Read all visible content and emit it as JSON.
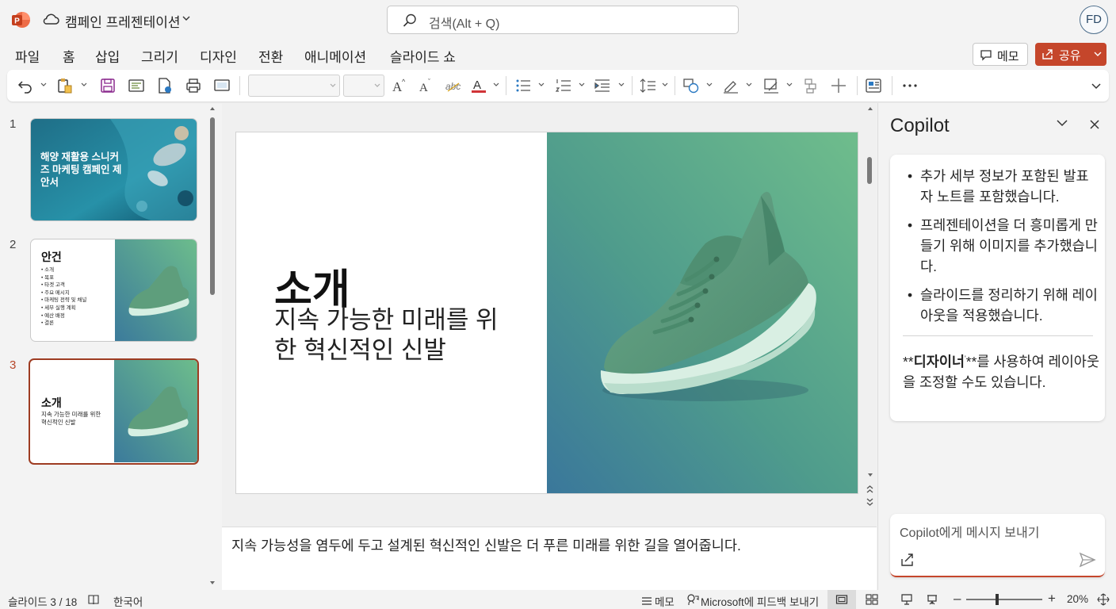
{
  "titlebar": {
    "doc_title": "캠페인 프레젠테이션",
    "search_placeholder": "검색(Alt + Q)",
    "avatar_initials": "FD"
  },
  "tabs": [
    {
      "label": "파일",
      "active": false
    },
    {
      "label": "홈",
      "active": true
    },
    {
      "label": "삽입",
      "active": false
    },
    {
      "label": "그리기",
      "active": false
    },
    {
      "label": "디자인",
      "active": false
    },
    {
      "label": "전환",
      "active": false
    },
    {
      "label": "애니메이션",
      "active": false
    },
    {
      "label": "슬라이드 쇼",
      "active": false
    }
  ],
  "header_buttons": {
    "comment_label": "메모",
    "share_label": "공유"
  },
  "thumbnails": [
    {
      "number": "1",
      "title": "해양 재활용 스니커즈 마케팅 캠페인 제안서"
    },
    {
      "number": "2",
      "title": "안건",
      "items": [
        "소개",
        "목표",
        "타겟 고객",
        "주요 메시지",
        "마케팅 전략 및 채널",
        "세부 실행 계획",
        "예산 배정",
        "결론"
      ]
    },
    {
      "number": "3",
      "title": "소개",
      "subtitle": "지속 가능한 미래를 위한 혁신적인 신발"
    }
  ],
  "slide": {
    "title": "소개",
    "subtitle": "지속 가능한 미래를 위한 혁신적인 신발"
  },
  "notes": "지속 가능성을 염두에 두고 설계된 혁신적인 신발은 더 푸른 미래를 위한 길을 열어줍니다.",
  "copilot": {
    "title": "Copilot",
    "bullets": [
      "추가 세부 정보가 포함된 발표자 노트를 포함했습니다.",
      "프레젠테이션을 더 흥미롭게 만들기 위해 이미지를 추가했습니다.",
      "슬라이드를 정리하기 위해 레이아웃을 적용했습니다."
    ],
    "note_bold": "디자이너",
    "note_rest": "를 사용하여 레이아웃을 조정할 수도 있습니다.",
    "input_placeholder": "Copilot에게 메시지 보내기"
  },
  "statusbar": {
    "slide_count": "슬라이드 3 / 18",
    "language": "한국어",
    "notes_label": "메모",
    "feedback_label": "Microsoft에 피드백 보내기",
    "zoom": "20%",
    "zoom_level": 0.2
  },
  "colors": {
    "accent": "#c5462b",
    "selected_thumb_border": "#9e3c22",
    "slide_image_green": "#6db88e",
    "slide_image_blue": "#3d7f9c"
  }
}
